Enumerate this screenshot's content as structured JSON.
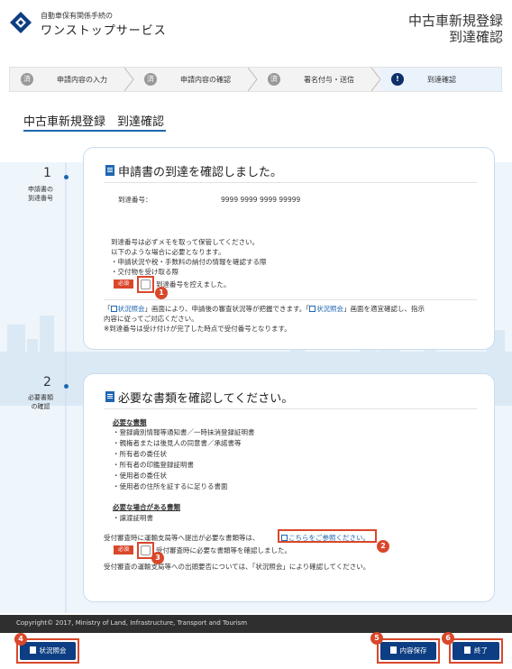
{
  "header": {
    "logo_sub": "自動車保有関係手続の",
    "logo_main": "ワンストップサービス",
    "title_line1": "中古車新規登録",
    "title_line2": "到達確認"
  },
  "stepper": {
    "steps": [
      {
        "icon": "済",
        "label": "申請内容の入力"
      },
      {
        "icon": "済",
        "label": "申請内容の確認"
      },
      {
        "icon": "済",
        "label": "署名付与・送信"
      },
      {
        "icon": "!",
        "label": "到達確認"
      }
    ]
  },
  "page_heading": "中古車新規登録　到達確認",
  "section1": {
    "num": "1",
    "side_label_1": "申請書の",
    "side_label_2": "到達番号",
    "title": "申請書の到達を確認しました。",
    "arrival_label": "到達番号：",
    "arrival_value": "9999 9999 9999 99999",
    "note1": "到達番号は必ずメモを取って保管してください。",
    "note2": "以下のような場合に必要となります。",
    "note3": "・申請状況や税・手数料の納付の情報を確認する際",
    "note4": "・交付物を受け取る際",
    "required": "必須",
    "check_label": "到達番号を控えました。",
    "info1_link1": "状況照会",
    "info1_a": "画面により、申請後の審査状況等が把握できます。「",
    "info1_link2": "状況照会",
    "info1_b": "」画面を適宜確認し、指示",
    "info2": "内容に従ってご対応ください。",
    "info3": "※到達番号は受け付けが完了した時点で受付番号となります。"
  },
  "section2": {
    "num": "2",
    "side_label_1": "必要書類",
    "side_label_2": "の確認",
    "title": "必要な書類を確認してください。",
    "req_heading": "必要な書類",
    "req_items": [
      "・登録識別情報等通知書／一時抹消登録証明書",
      "・親権者または後見人の同意書／承諾書等",
      "・所有者の委任状",
      "・所有者の印鑑登録証明書",
      "・使用者の委任状",
      "・使用者の住所を証するに足りる書面"
    ],
    "cond_heading": "必要な場合がある書類",
    "cond_items": [
      "・譲渡証明書"
    ],
    "submit_note": "受付審査時に運輸支局等へ提出が必要な書類等は、",
    "submit_link": "こちらをご参照ください。",
    "required": "必須",
    "check_label": "受付審査時に必要な書類等を確認しました。",
    "footnote": "受付審査の運輸支局等への出頭要否については、「状況照会」により確認してください。"
  },
  "badges": [
    "1",
    "2",
    "3",
    "4",
    "5",
    "6"
  ],
  "footer": {
    "copyright": "Copyright© 2017, Ministry of Land, Infrastructure, Transport and Tourism"
  },
  "buttons": {
    "status": "状況照会",
    "save": "内容保存",
    "end": "終了"
  },
  "colors": {
    "accent": "#1f66b0",
    "navy": "#0d3d82",
    "required": "#d9472b",
    "footer": "#2f2f2f"
  }
}
